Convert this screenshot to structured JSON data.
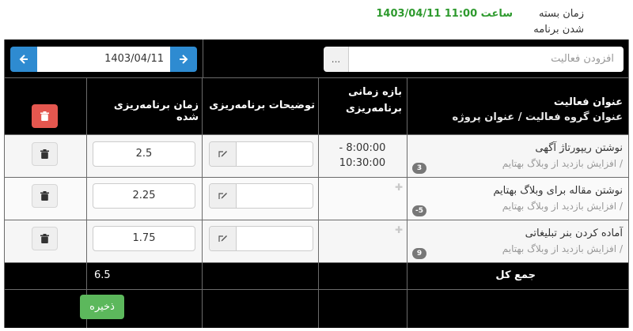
{
  "header": {
    "closing_label": "زمان بسته شدن برنامه",
    "closing_value": "1403/04/11 ساعت 11:00"
  },
  "toolbar": {
    "date_value": "1403/04/11",
    "activity_placeholder": "افزودن فعالیت",
    "picker_label": "..."
  },
  "columns": {
    "activity_title": "عنوان فعالیت",
    "activity_sub": "عنوان گروه فعالیت / عنوان پروژه",
    "time_range": "بازه زمانی برنامه‌ریزی",
    "description": "توضیحات برنامه‌ریزی",
    "planned_time": "زمان برنامه‌ریزی شده"
  },
  "rows": [
    {
      "title": "نوشتن ریپورتاژ آگهی",
      "subtitle": "/ افزایش بازدید از وبلاگ بهتایم",
      "badge": "3",
      "range": "- 8:00:00\n10:30:00",
      "planned": "2.5"
    },
    {
      "title": "نوشتن مقاله برای وبلاگ بهتایم",
      "subtitle": "/ افزایش بازدید از وبلاگ بهتایم",
      "badge": "-5",
      "range": "",
      "planned": "2.25"
    },
    {
      "title": "آماده کردن بنر تبلیغاتی",
      "subtitle": "/ افزایش بازدید از وبلاگ بهتایم",
      "badge": "9",
      "range": "",
      "planned": "1.75"
    }
  ],
  "footer": {
    "total_label": "جمع کل",
    "total_value": "6.5",
    "save_label": "ذخیره"
  },
  "colors": {
    "primary": "#2e8bd1",
    "danger": "#e4574f",
    "success": "#5cb85c",
    "header_green": "#2e9a2e"
  },
  "icons": {
    "nav_prev": "arrow-left-icon",
    "nav_next": "arrow-right-icon",
    "edit": "edit-icon",
    "delete": "trash-icon",
    "add": "plus-icon"
  }
}
